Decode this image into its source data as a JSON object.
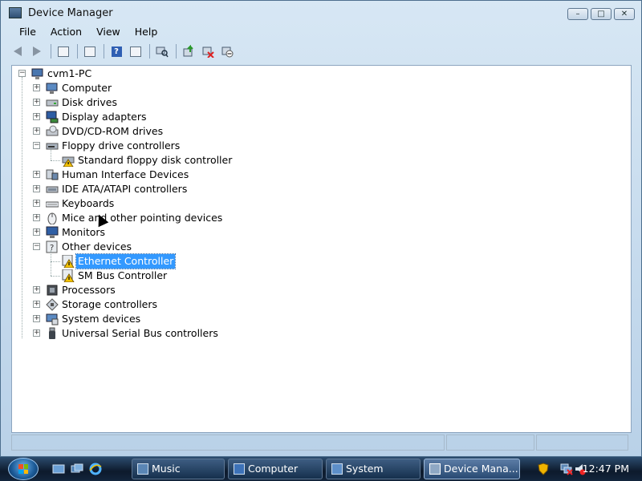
{
  "window": {
    "title": "Device Manager",
    "controls": {
      "minimize": "–",
      "maximize": "□",
      "close": "✕"
    }
  },
  "menu": [
    "File",
    "Action",
    "View",
    "Help"
  ],
  "toolbar": {
    "icons": [
      "back-icon",
      "forward-icon",
      "show-hide-console-tree-icon",
      "properties-icon",
      "help-icon",
      "action-pane-icon",
      "scan-hardware-icon",
      "update-driver-icon",
      "uninstall-icon",
      "disable-icon"
    ]
  },
  "tree": {
    "root": "cvm1-PC",
    "items": [
      {
        "label": "Computer",
        "expanded": false
      },
      {
        "label": "Disk drives",
        "expanded": false
      },
      {
        "label": "Display adapters",
        "expanded": false
      },
      {
        "label": "DVD/CD-ROM drives",
        "expanded": false
      },
      {
        "label": "Floppy drive controllers",
        "expanded": true,
        "children": [
          {
            "label": "Standard floppy disk controller",
            "warning": true
          }
        ]
      },
      {
        "label": "Human Interface Devices",
        "expanded": false
      },
      {
        "label": "IDE ATA/ATAPI controllers",
        "expanded": false
      },
      {
        "label": "Keyboards",
        "expanded": false
      },
      {
        "label": "Mice and other pointing devices",
        "expanded": false
      },
      {
        "label": "Monitors",
        "expanded": false
      },
      {
        "label": "Other devices",
        "expanded": true,
        "children": [
          {
            "label": "Ethernet Controller",
            "warning": true,
            "selected": true
          },
          {
            "label": "SM Bus Controller",
            "warning": true
          }
        ]
      },
      {
        "label": "Processors",
        "expanded": false
      },
      {
        "label": "Storage controllers",
        "expanded": false
      },
      {
        "label": "System devices",
        "expanded": false
      },
      {
        "label": "Universal Serial Bus controllers",
        "expanded": false
      }
    ]
  },
  "taskbar": {
    "tasks": [
      {
        "label": "Music",
        "active": false
      },
      {
        "label": "Computer",
        "active": false
      },
      {
        "label": "System",
        "active": false
      },
      {
        "label": "Device Mana...",
        "active": true
      }
    ],
    "clock": "12:47 PM"
  },
  "colors": {
    "selection": "#3399ff",
    "warning": "#f5c400"
  }
}
